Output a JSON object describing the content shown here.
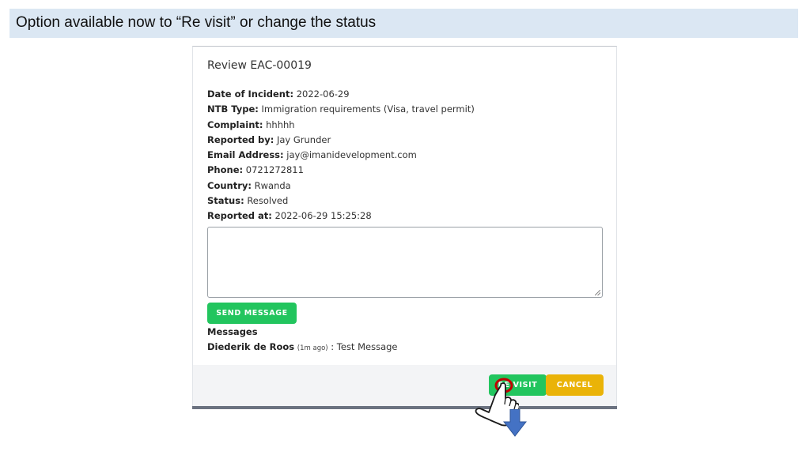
{
  "banner": {
    "text": "Option available now to “Re visit” or change the status"
  },
  "modal": {
    "title": "Review EAC-00019",
    "details": [
      {
        "label": "Date of Incident:",
        "value": "2022-06-29"
      },
      {
        "label": "NTB Type:",
        "value": "Immigration requirements (Visa, travel permit)"
      },
      {
        "label": "Complaint:",
        "value": "hhhhh"
      },
      {
        "label": "Reported by:",
        "value": "Jay Grunder"
      },
      {
        "label": "Email Address:",
        "value": "jay@imanidevelopment.com"
      },
      {
        "label": "Phone:",
        "value": "0721272811"
      },
      {
        "label": "Country:",
        "value": "Rwanda"
      },
      {
        "label": "Status:",
        "value": "Resolved"
      },
      {
        "label": "Reported at:",
        "value": "2022-06-29 15:25:28"
      }
    ],
    "message_input": {
      "value": "",
      "placeholder": ""
    },
    "send_label": "SEND MESSAGE",
    "messages_heading": "Messages",
    "messages": [
      {
        "author": "Diederik de Roos",
        "ago": "(1m ago)",
        "separator": ":",
        "text": "Test Message"
      }
    ],
    "footer": {
      "revisit_label": "RE VISIT",
      "cancel_label": "CANCEL"
    }
  },
  "annotations": {
    "pointer_icon": "hand-pointer-icon",
    "arrow_icon": "arrow-down-icon",
    "colors": {
      "arrow": "#4472c4",
      "highlight": "#c00000",
      "green": "#22c55e",
      "yellow": "#eab308"
    }
  }
}
